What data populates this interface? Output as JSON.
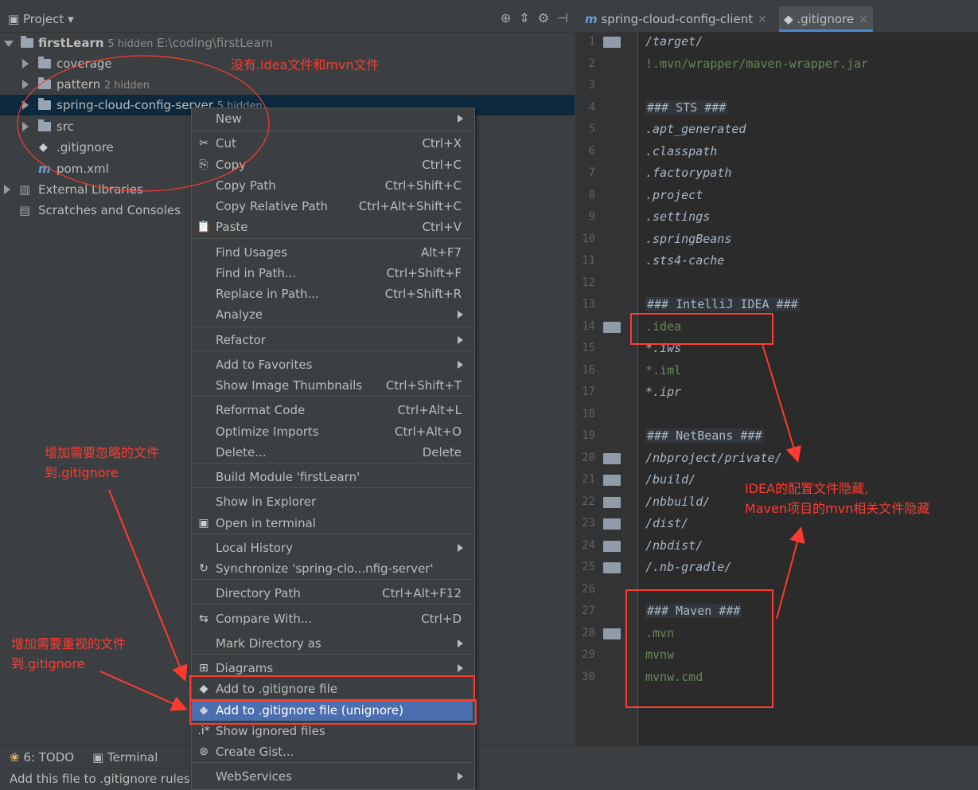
{
  "project_panel": {
    "title": "Project",
    "tree": [
      {
        "label": "firstLearn",
        "hidden": "5 hidden",
        "path": "E:\\coding\\firstLearn"
      },
      {
        "label": "coverage"
      },
      {
        "label": "pattern",
        "hidden": "2 hidden"
      },
      {
        "label": "spring-cloud-config-server",
        "hidden": "5 hidden"
      },
      {
        "label": "src"
      },
      {
        "label": ".gitignore"
      },
      {
        "label": "pom.xml"
      },
      {
        "label": "External Libraries"
      },
      {
        "label": "Scratches and Consoles"
      }
    ]
  },
  "editor": {
    "tabs": [
      {
        "label": "spring-cloud-config-client",
        "icon": "maven-m-icon"
      },
      {
        "label": ".gitignore",
        "icon": "git-icon"
      }
    ],
    "lines": [
      {
        "n": "1",
        "text": "/target/"
      },
      {
        "n": "2",
        "text": "!.mvn/wrapper/maven-wrapper.jar"
      },
      {
        "n": "3",
        "text": ""
      },
      {
        "n": "4",
        "text": "### STS ###"
      },
      {
        "n": "5",
        "text": ".apt_generated"
      },
      {
        "n": "6",
        "text": ".classpath"
      },
      {
        "n": "7",
        "text": ".factorypath"
      },
      {
        "n": "8",
        "text": ".project"
      },
      {
        "n": "9",
        "text": ".settings"
      },
      {
        "n": "10",
        "text": ".springBeans"
      },
      {
        "n": "11",
        "text": ".sts4-cache"
      },
      {
        "n": "12",
        "text": ""
      },
      {
        "n": "13",
        "text": "### IntelliJ IDEA ###"
      },
      {
        "n": "14",
        "text": ".idea"
      },
      {
        "n": "15",
        "text": "*.iws"
      },
      {
        "n": "16",
        "text": "*.iml"
      },
      {
        "n": "17",
        "text": "*.ipr"
      },
      {
        "n": "18",
        "text": ""
      },
      {
        "n": "19",
        "text": "### NetBeans ###"
      },
      {
        "n": "20",
        "text": "/nbproject/private/"
      },
      {
        "n": "21",
        "text": "/build/"
      },
      {
        "n": "22",
        "text": "/nbbuild/"
      },
      {
        "n": "23",
        "text": "/dist/"
      },
      {
        "n": "24",
        "text": "/nbdist/"
      },
      {
        "n": "25",
        "text": "/.nb-gradle/"
      },
      {
        "n": "26",
        "text": ""
      },
      {
        "n": "27",
        "text": "### Maven ###"
      },
      {
        "n": "28",
        "text": ".mvn"
      },
      {
        "n": "29",
        "text": "mvnw"
      },
      {
        "n": "30",
        "text": "mvnw.cmd"
      }
    ]
  },
  "context_menu": {
    "items": [
      {
        "label": "New",
        "shortcut": ""
      },
      {
        "label": "Cut",
        "shortcut": "Ctrl+X"
      },
      {
        "label": "Copy",
        "shortcut": "Ctrl+C"
      },
      {
        "label": "Copy Path",
        "shortcut": "Ctrl+Shift+C"
      },
      {
        "label": "Copy Relative Path",
        "shortcut": "Ctrl+Alt+Shift+C"
      },
      {
        "label": "Paste",
        "shortcut": "Ctrl+V"
      },
      {
        "label": "Find Usages",
        "shortcut": "Alt+F7"
      },
      {
        "label": "Find in Path...",
        "shortcut": "Ctrl+Shift+F"
      },
      {
        "label": "Replace in Path...",
        "shortcut": "Ctrl+Shift+R"
      },
      {
        "label": "Analyze",
        "shortcut": ""
      },
      {
        "label": "Refactor",
        "shortcut": ""
      },
      {
        "label": "Add to Favorites",
        "shortcut": ""
      },
      {
        "label": "Show Image Thumbnails",
        "shortcut": "Ctrl+Shift+T"
      },
      {
        "label": "Reformat Code",
        "shortcut": "Ctrl+Alt+L"
      },
      {
        "label": "Optimize Imports",
        "shortcut": "Ctrl+Alt+O"
      },
      {
        "label": "Delete...",
        "shortcut": "Delete"
      },
      {
        "label": "Build Module 'firstLearn'",
        "shortcut": ""
      },
      {
        "label": "Show in Explorer",
        "shortcut": ""
      },
      {
        "label": "Open in terminal",
        "shortcut": ""
      },
      {
        "label": "Local History",
        "shortcut": ""
      },
      {
        "label": "Synchronize 'spring-clo...nfig-server'",
        "shortcut": ""
      },
      {
        "label": "Directory Path",
        "shortcut": "Ctrl+Alt+F12"
      },
      {
        "label": "Compare With...",
        "shortcut": "Ctrl+D"
      },
      {
        "label": "Mark Directory as",
        "shortcut": ""
      },
      {
        "label": "Diagrams",
        "shortcut": ""
      },
      {
        "label": "Add to .gitignore file",
        "shortcut": ""
      },
      {
        "label": "Add to .gitignore file (unignore)",
        "shortcut": ""
      },
      {
        "label": "Show ignored files",
        "shortcut": ""
      },
      {
        "label": "Create Gist...",
        "shortcut": ""
      },
      {
        "label": "WebServices",
        "shortcut": ""
      }
    ]
  },
  "bottom": {
    "todo": "6: TODO",
    "terminal": "Terminal",
    "status": "Add this file to .gitignore rules ("
  },
  "annotations": {
    "no_idea_mvn": "没有.idea文件和mvn文件",
    "add_ignore_1": "增加需要忽略的文件",
    "add_ignore_2": "到.gitignore",
    "add_unignore_1": "增加需要重视的文件",
    "add_unignore_2": "到.gitignore",
    "hidden_1": "IDEA的配置文件隐藏,",
    "hidden_2": "Maven项目的mvn相关文件隐藏"
  },
  "colors": {
    "annotation_red": "#ff3b30",
    "menu_highlight": "#4b6eaf",
    "selection": "#0d293e"
  }
}
